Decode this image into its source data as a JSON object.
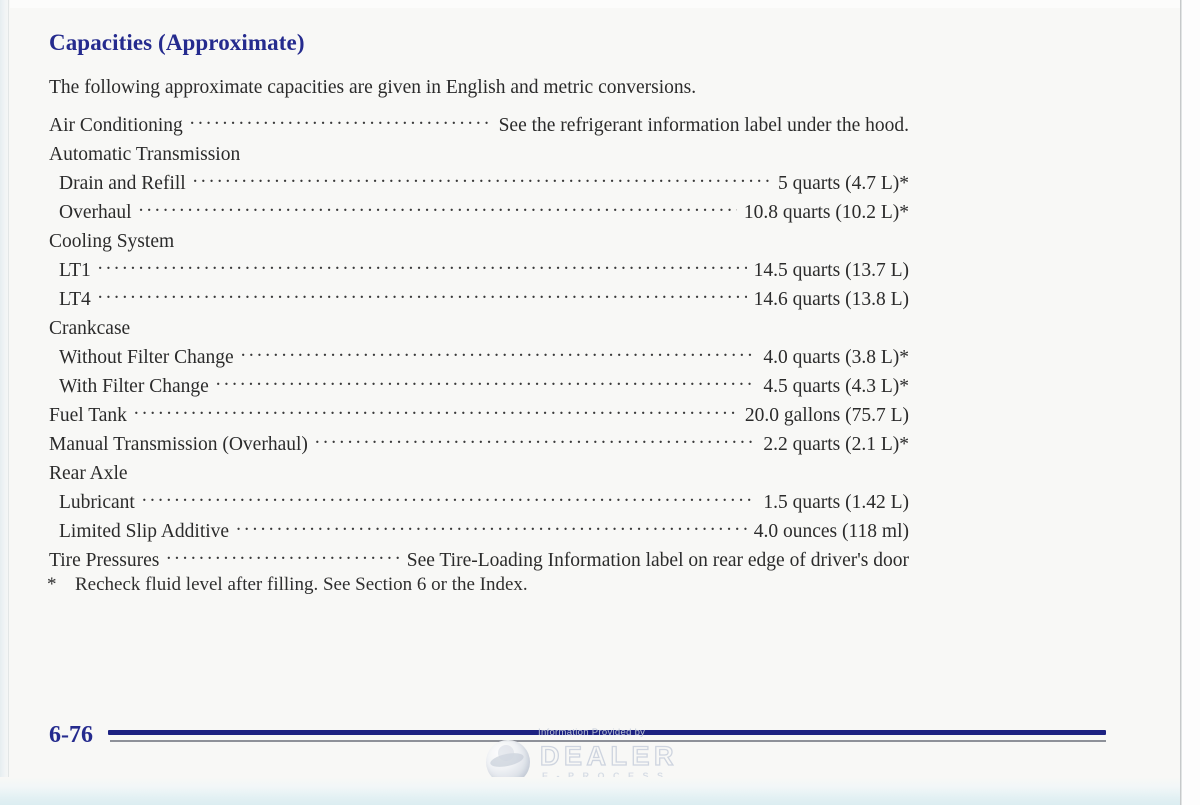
{
  "document": {
    "title": "Capacities (Approximate)",
    "title_color": "#252b8e",
    "intro": "The following approximate capacities are given in English and metric conversions.",
    "page_number": "6-76",
    "footnote_marker": "*",
    "footnote_text": "Recheck fluid level after filling. See Section 6 or the Index.",
    "body_text_color": "#2b2b2b",
    "page_background": "#f8f8f6"
  },
  "capacities": [
    {
      "label": "Air Conditioning",
      "indent": 0,
      "leader": true,
      "value": "See the refrigerant information label under the hood.",
      "note": ""
    },
    {
      "label": "Automatic Transmission",
      "indent": 0,
      "leader": false,
      "value": "",
      "note": ""
    },
    {
      "label": "Drain and Refill",
      "indent": 1,
      "leader": true,
      "value": "5 quarts (4.7 L)",
      "note": "*"
    },
    {
      "label": "Overhaul",
      "indent": 1,
      "leader": true,
      "value": "10.8 quarts (10.2 L)",
      "note": "*"
    },
    {
      "label": "Cooling System",
      "indent": 0,
      "leader": false,
      "value": "",
      "note": ""
    },
    {
      "label": "LT1",
      "indent": 1,
      "leader": true,
      "value": "14.5 quarts (13.7 L)",
      "note": ""
    },
    {
      "label": "LT4",
      "indent": 1,
      "leader": true,
      "value": "14.6 quarts (13.8 L)",
      "note": ""
    },
    {
      "label": "Crankcase",
      "indent": 0,
      "leader": false,
      "value": "",
      "note": ""
    },
    {
      "label": "Without Filter Change",
      "indent": 1,
      "leader": true,
      "value": "4.0 quarts (3.8 L)",
      "note": "*"
    },
    {
      "label": "With Filter Change",
      "indent": 1,
      "leader": true,
      "value": "4.5 quarts (4.3 L)",
      "note": "*"
    },
    {
      "label": "Fuel Tank",
      "indent": 0,
      "leader": true,
      "value": "20.0 gallons (75.7 L)",
      "note": ""
    },
    {
      "label": "Manual Transmission (Overhaul)",
      "indent": 0,
      "leader": true,
      "value": "2.2 quarts (2.1 L)",
      "note": "*"
    },
    {
      "label": "Rear Axle",
      "indent": 0,
      "leader": false,
      "value": "",
      "note": ""
    },
    {
      "label": "Lubricant",
      "indent": 1,
      "leader": true,
      "value": "1.5 quarts (1.42 L)",
      "note": ""
    },
    {
      "label": "Limited Slip Additive",
      "indent": 1,
      "leader": true,
      "value": "4.0 ounces (118 ml)",
      "note": ""
    },
    {
      "label": "Tire Pressures",
      "indent": 0,
      "leader": true,
      "value": "See Tire-Loading Information label on rear edge of driver's door",
      "note": ""
    }
  ],
  "footer": {
    "rule_color": "#1d2282",
    "rule_secondary_color": "#8e9199"
  },
  "watermark": {
    "provided_by": "Information Provided by",
    "brand": "DEALER",
    "brand_sub": "E-PROCESS",
    "globe_icon": "globe-icon",
    "color": "#ccd3de"
  }
}
